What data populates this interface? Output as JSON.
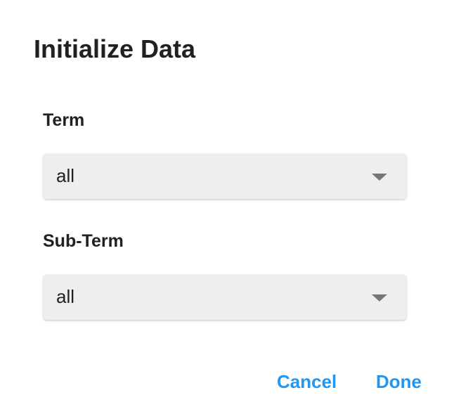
{
  "dialog": {
    "title": "Initialize Data"
  },
  "fields": {
    "term": {
      "label": "Term",
      "value": "all"
    },
    "sub_term": {
      "label": "Sub-Term",
      "value": "all"
    }
  },
  "actions": {
    "cancel_label": "Cancel",
    "done_label": "Done"
  },
  "colors": {
    "accent": "#2196f3",
    "select_background": "#eeeeee",
    "text": "#212121",
    "caret": "#757575"
  },
  "icons": {
    "dropdown": "chevron-down-icon"
  }
}
